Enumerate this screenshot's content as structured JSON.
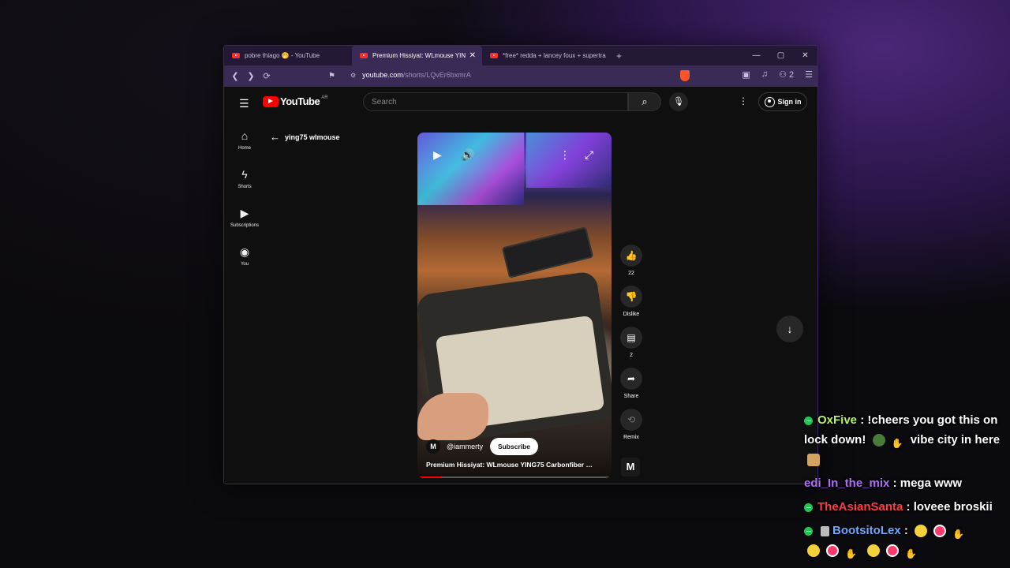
{
  "browser": {
    "tabs": [
      {
        "label": "pobre thiago 🤭 - YouTube",
        "active": false
      },
      {
        "label": "Premium Hissiyat: WLmouse YIN",
        "active": true,
        "close": "✕"
      },
      {
        "label": "*free* redda + lancey foux + supertra",
        "active": false
      }
    ],
    "new_tab": "+",
    "window_controls": {
      "minimize": "—",
      "maximize": "▢",
      "close": "✕"
    },
    "url_site": "youtube.com",
    "url_path": "/shorts/LQvEr6bxmrA",
    "extension_count": "2"
  },
  "youtube": {
    "logo_text": "YouTube",
    "country_code": "AR",
    "search_placeholder": "Search",
    "sign_in": "Sign in",
    "sidebar": [
      {
        "icon": "home-icon",
        "label": "Home"
      },
      {
        "icon": "shorts-icon",
        "label": "Shorts"
      },
      {
        "icon": "subscriptions-icon",
        "label": "Subscriptions"
      },
      {
        "icon": "you-icon",
        "label": "You"
      }
    ],
    "back_title": "ying75 wlmouse",
    "short": {
      "channel": "@iammerty",
      "subscribe": "Subscribe",
      "title": "Premium Hissiyat: WLmouse YING75 Carbonfiber …",
      "progress": 0.12,
      "avatar_letter": "M"
    },
    "actions": {
      "like_count": "22",
      "dislike_label": "Dislike",
      "comment_count": "2",
      "share_label": "Share",
      "remix_label": "Remix"
    }
  },
  "chat": [
    {
      "user": "OxFive",
      "color": "#b7f06a",
      "verified": true,
      "text_a": ": !cheers you got this on lock down!",
      "text_b": "vibe city in here"
    },
    {
      "user": "edi_In_the_mix",
      "color": "#b06ef5",
      "verified": false,
      "text_a": ": mega www"
    },
    {
      "user": "TheAsianSanta",
      "color": "#ff3b4a",
      "verified": true,
      "text_a": ": loveee broskii"
    },
    {
      "user": "BootsitoLex",
      "color": "#6fa9ff",
      "verified": true,
      "text_a": ":"
    }
  ]
}
